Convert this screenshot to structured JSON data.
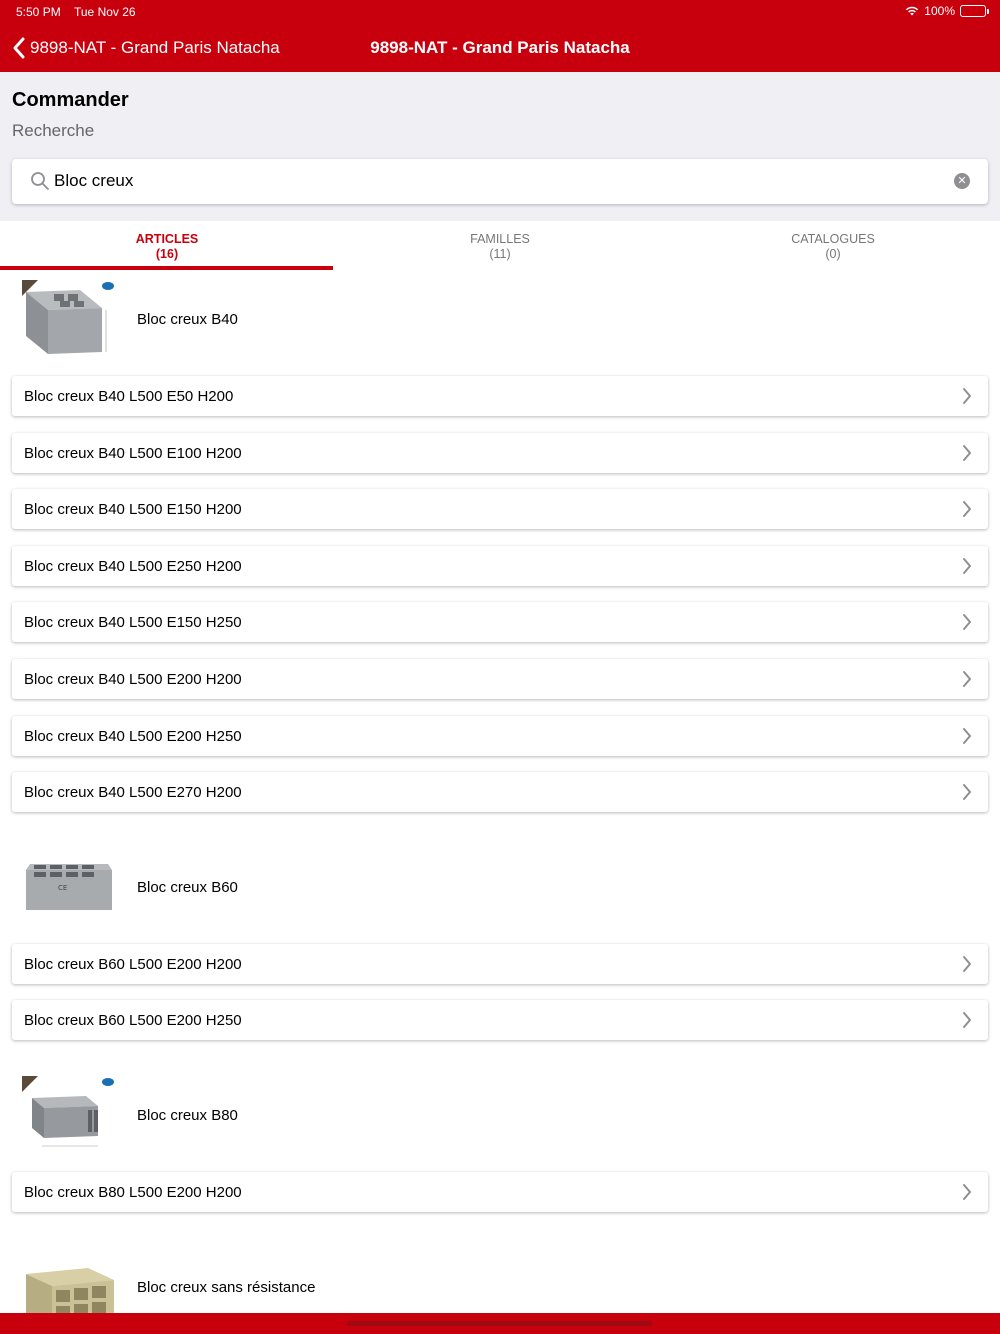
{
  "status": {
    "time": "5:50 PM",
    "date": "Tue Nov 26",
    "battery": "100%"
  },
  "nav": {
    "back_label": "9898-NAT - Grand Paris Natacha",
    "title": "9898-NAT - Grand Paris Natacha"
  },
  "page": {
    "title": "Commander",
    "subtitle": "Recherche"
  },
  "search": {
    "value": "Bloc creux",
    "clear_icon": "clear-icon"
  },
  "tabs": [
    {
      "label": "ARTICLES",
      "count": "(16)",
      "active": true
    },
    {
      "label": "FAMILLES",
      "count": "(11)",
      "active": false
    },
    {
      "label": "CATALOGUES",
      "count": "(0)",
      "active": false
    }
  ],
  "groups": [
    {
      "name": "Bloc creux B40",
      "items": [
        "Bloc creux B40 L500 E50 H200",
        "Bloc creux B40 L500 E100 H200",
        "Bloc creux B40 L500 E150 H200",
        "Bloc creux B40 L500 E250 H200",
        "Bloc creux B40 L500 E150 H250",
        "Bloc creux B40 L500 E200 H200",
        "Bloc creux B40 L500 E200 H250",
        "Bloc creux B40 L500 E270 H200"
      ]
    },
    {
      "name": "Bloc creux B60",
      "items": [
        "Bloc creux B60 L500 E200 H200",
        "Bloc creux B60 L500 E200 H250"
      ]
    },
    {
      "name": "Bloc creux B80",
      "items": [
        "Bloc creux B80 L500 E200 H200"
      ]
    },
    {
      "name": "Bloc creux sans résistance",
      "items": []
    }
  ],
  "colors": {
    "brand": "#c8000d",
    "background": "#efeff4"
  }
}
